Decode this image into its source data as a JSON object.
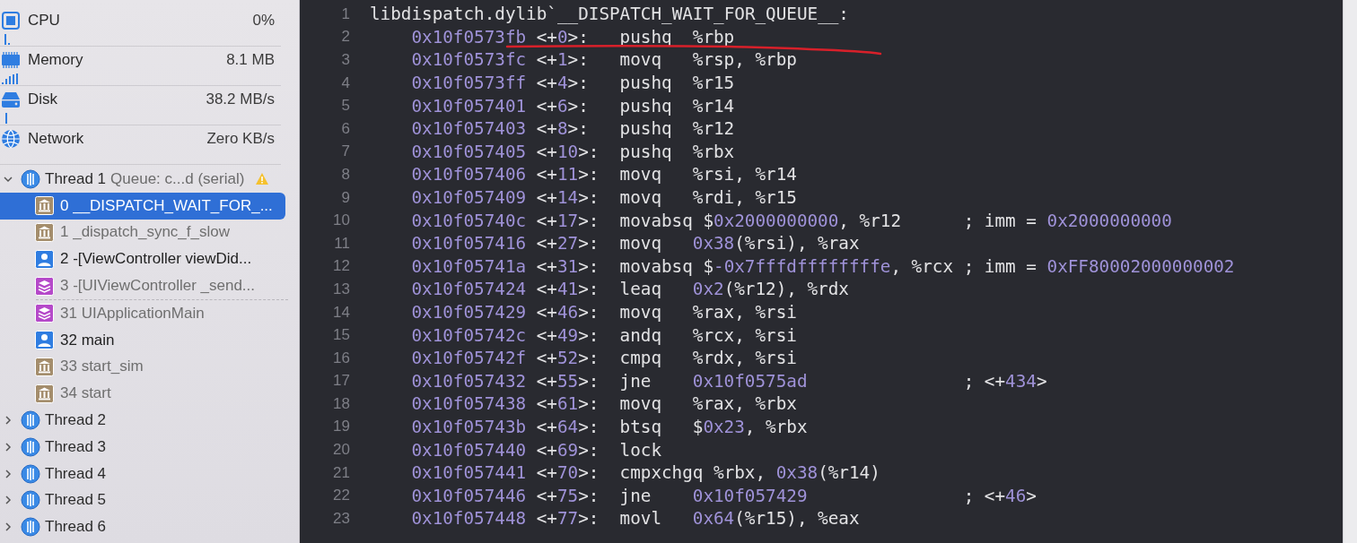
{
  "gauges": [
    {
      "kind": "cpu",
      "name": "CPU",
      "value": "0%"
    },
    {
      "kind": "memory",
      "name": "Memory",
      "value": "8.1 MB"
    },
    {
      "kind": "disk",
      "name": "Disk",
      "value": "38.2 MB/s"
    },
    {
      "kind": "network",
      "name": "Network",
      "value": "Zero KB/s"
    }
  ],
  "threads": [
    {
      "label": "Thread 1",
      "queue": "Queue: c...d (serial)",
      "expanded": true,
      "warning": true,
      "children": [
        {
          "label": "0 __DISPATCH_WAIT_FOR_...",
          "kind": "library",
          "selected": true,
          "elided_before": false
        },
        {
          "label": "1 _dispatch_sync_f_slow",
          "kind": "library",
          "selected": false,
          "elided_before": false
        },
        {
          "label": "2 -[ViewController viewDid...",
          "kind": "user",
          "selected": false,
          "elided_before": false
        },
        {
          "label": "3 -[UIViewController _send...",
          "kind": "framework",
          "selected": false,
          "elided_before": false
        },
        {
          "label": "31 UIApplicationMain",
          "kind": "framework",
          "selected": false,
          "elided_before": true
        },
        {
          "label": "32 main",
          "kind": "user",
          "selected": false,
          "elided_before": false
        },
        {
          "label": "33 start_sim",
          "kind": "library",
          "selected": false,
          "elided_before": false
        },
        {
          "label": "34 start",
          "kind": "library",
          "selected": false,
          "elided_before": false
        }
      ]
    },
    {
      "label": "Thread 2",
      "expanded": false,
      "warning": false
    },
    {
      "label": "Thread 3",
      "expanded": false,
      "warning": false
    },
    {
      "label": "Thread 4",
      "expanded": false,
      "warning": false
    },
    {
      "label": "Thread 5",
      "expanded": false,
      "warning": false
    },
    {
      "label": "Thread 6",
      "expanded": false,
      "warning": false
    }
  ],
  "disassembly": {
    "annotations": [
      {
        "kind": "freehand-stroke"
      }
    ],
    "lines": [
      {
        "number": "1",
        "kind": "header",
        "text": "libdispatch.dylib`__DISPATCH_WAIT_FOR_QUEUE__:"
      },
      {
        "number": "2",
        "kind": "instruction",
        "address": "0x10f0573fb",
        "offset": {
          "prefix": "<+",
          "value": "0",
          "suffix": ">:"
        },
        "mnemonic": "pushq",
        "operands": [
          {
            "text": "%rbp",
            "kind": "plain"
          }
        ]
      },
      {
        "number": "3",
        "kind": "instruction",
        "address": "0x10f0573fc",
        "offset": {
          "prefix": "<+",
          "value": "1",
          "suffix": ">:"
        },
        "mnemonic": "movq",
        "operands": [
          {
            "text": "%rsp, %rbp",
            "kind": "plain"
          }
        ]
      },
      {
        "number": "4",
        "kind": "instruction",
        "address": "0x10f0573ff",
        "offset": {
          "prefix": "<+",
          "value": "4",
          "suffix": ">:"
        },
        "mnemonic": "pushq",
        "operands": [
          {
            "text": "%r15",
            "kind": "plain"
          }
        ]
      },
      {
        "number": "5",
        "kind": "instruction",
        "address": "0x10f057401",
        "offset": {
          "prefix": "<+",
          "value": "6",
          "suffix": ">:"
        },
        "mnemonic": "pushq",
        "operands": [
          {
            "text": "%r14",
            "kind": "plain"
          }
        ]
      },
      {
        "number": "6",
        "kind": "instruction",
        "address": "0x10f057403",
        "offset": {
          "prefix": "<+",
          "value": "8",
          "suffix": ">:"
        },
        "mnemonic": "pushq",
        "operands": [
          {
            "text": "%r12",
            "kind": "plain"
          }
        ]
      },
      {
        "number": "7",
        "kind": "instruction",
        "address": "0x10f057405",
        "offset": {
          "prefix": "<+",
          "value": "10",
          "suffix": ">:"
        },
        "mnemonic": "pushq",
        "operands": [
          {
            "text": "%rbx",
            "kind": "plain"
          }
        ]
      },
      {
        "number": "8",
        "kind": "instruction",
        "address": "0x10f057406",
        "offset": {
          "prefix": "<+",
          "value": "11",
          "suffix": ">:"
        },
        "mnemonic": "movq",
        "operands": [
          {
            "text": "%rsi, %r14",
            "kind": "plain"
          }
        ]
      },
      {
        "number": "9",
        "kind": "instruction",
        "address": "0x10f057409",
        "offset": {
          "prefix": "<+",
          "value": "14",
          "suffix": ">:"
        },
        "mnemonic": "movq",
        "operands": [
          {
            "text": "%rdi, %r15",
            "kind": "plain"
          }
        ]
      },
      {
        "number": "10",
        "kind": "instruction",
        "address": "0x10f05740c",
        "offset": {
          "prefix": "<+",
          "value": "17",
          "suffix": ">:"
        },
        "mnemonic": "movabsq",
        "operands": [
          {
            "text": "$",
            "kind": "plain"
          },
          {
            "text": "0x2000000000",
            "kind": "number"
          },
          {
            "text": ", %r12",
            "kind": "plain"
          }
        ],
        "comment": [
          {
            "text": "; imm = ",
            "kind": "plain"
          },
          {
            "text": "0x2000000000",
            "kind": "number"
          }
        ]
      },
      {
        "number": "11",
        "kind": "instruction",
        "address": "0x10f057416",
        "offset": {
          "prefix": "<+",
          "value": "27",
          "suffix": ">:"
        },
        "mnemonic": "movq",
        "operands": [
          {
            "text": "0x38",
            "kind": "number"
          },
          {
            "text": "(%rsi), %rax",
            "kind": "plain"
          }
        ]
      },
      {
        "number": "12",
        "kind": "instruction",
        "address": "0x10f05741a",
        "offset": {
          "prefix": "<+",
          "value": "31",
          "suffix": ">:"
        },
        "mnemonic": "movabsq",
        "operands": [
          {
            "text": "$",
            "kind": "plain"
          },
          {
            "text": "-0x7fffdffffffffe",
            "kind": "number"
          },
          {
            "text": ", %rcx",
            "kind": "plain"
          }
        ],
        "comment": [
          {
            "text": "; imm = ",
            "kind": "plain"
          },
          {
            "text": "0xFF80002000000002",
            "kind": "number"
          }
        ]
      },
      {
        "number": "13",
        "kind": "instruction",
        "address": "0x10f057424",
        "offset": {
          "prefix": "<+",
          "value": "41",
          "suffix": ">:"
        },
        "mnemonic": "leaq",
        "operands": [
          {
            "text": "0x2",
            "kind": "number"
          },
          {
            "text": "(%r12), %rdx",
            "kind": "plain"
          }
        ]
      },
      {
        "number": "14",
        "kind": "instruction",
        "address": "0x10f057429",
        "offset": {
          "prefix": "<+",
          "value": "46",
          "suffix": ">:"
        },
        "mnemonic": "movq",
        "operands": [
          {
            "text": "%rax, %rsi",
            "kind": "plain"
          }
        ]
      },
      {
        "number": "15",
        "kind": "instruction",
        "address": "0x10f05742c",
        "offset": {
          "prefix": "<+",
          "value": "49",
          "suffix": ">:"
        },
        "mnemonic": "andq",
        "operands": [
          {
            "text": "%rcx, %rsi",
            "kind": "plain"
          }
        ]
      },
      {
        "number": "16",
        "kind": "instruction",
        "address": "0x10f05742f",
        "offset": {
          "prefix": "<+",
          "value": "52",
          "suffix": ">:"
        },
        "mnemonic": "cmpq",
        "operands": [
          {
            "text": "%rdx, %rsi",
            "kind": "plain"
          }
        ]
      },
      {
        "number": "17",
        "kind": "instruction",
        "address": "0x10f057432",
        "offset": {
          "prefix": "<+",
          "value": "55",
          "suffix": ">:"
        },
        "mnemonic": "jne",
        "operands": [
          {
            "text": "0x10f0575ad",
            "kind": "number"
          }
        ],
        "comment": [
          {
            "text": "; <+",
            "kind": "plain"
          },
          {
            "text": "434",
            "kind": "number"
          },
          {
            "text": ">",
            "kind": "plain"
          }
        ]
      },
      {
        "number": "18",
        "kind": "instruction",
        "address": "0x10f057438",
        "offset": {
          "prefix": "<+",
          "value": "61",
          "suffix": ">:"
        },
        "mnemonic": "movq",
        "operands": [
          {
            "text": "%rax, %rbx",
            "kind": "plain"
          }
        ]
      },
      {
        "number": "19",
        "kind": "instruction",
        "address": "0x10f05743b",
        "offset": {
          "prefix": "<+",
          "value": "64",
          "suffix": ">:"
        },
        "mnemonic": "btsq",
        "operands": [
          {
            "text": "$",
            "kind": "plain"
          },
          {
            "text": "0x23",
            "kind": "number"
          },
          {
            "text": ", %rbx",
            "kind": "plain"
          }
        ]
      },
      {
        "number": "20",
        "kind": "instruction",
        "address": "0x10f057440",
        "offset": {
          "prefix": "<+",
          "value": "69",
          "suffix": ">:"
        },
        "mnemonic": "lock"
      },
      {
        "number": "21",
        "kind": "instruction",
        "address": "0x10f057441",
        "offset": {
          "prefix": "<+",
          "value": "70",
          "suffix": ">:"
        },
        "mnemonic": "cmpxchgq",
        "operands": [
          {
            "text": "%rbx, ",
            "kind": "plain"
          },
          {
            "text": "0x38",
            "kind": "number"
          },
          {
            "text": "(%r14)",
            "kind": "plain"
          }
        ]
      },
      {
        "number": "22",
        "kind": "instruction",
        "address": "0x10f057446",
        "offset": {
          "prefix": "<+",
          "value": "75",
          "suffix": ">:"
        },
        "mnemonic": "jne",
        "operands": [
          {
            "text": "0x10f057429",
            "kind": "number"
          }
        ],
        "comment": [
          {
            "text": "; <+",
            "kind": "plain"
          },
          {
            "text": "46",
            "kind": "number"
          },
          {
            "text": ">",
            "kind": "plain"
          }
        ]
      },
      {
        "number": "23",
        "kind": "instruction",
        "address": "0x10f057448",
        "offset": {
          "prefix": "<+",
          "value": "77",
          "suffix": ">:"
        },
        "mnemonic": "movl",
        "operands": [
          {
            "text": "0x64",
            "kind": "number"
          },
          {
            "text": "(%r15), %eax",
            "kind": "plain"
          }
        ]
      }
    ]
  }
}
